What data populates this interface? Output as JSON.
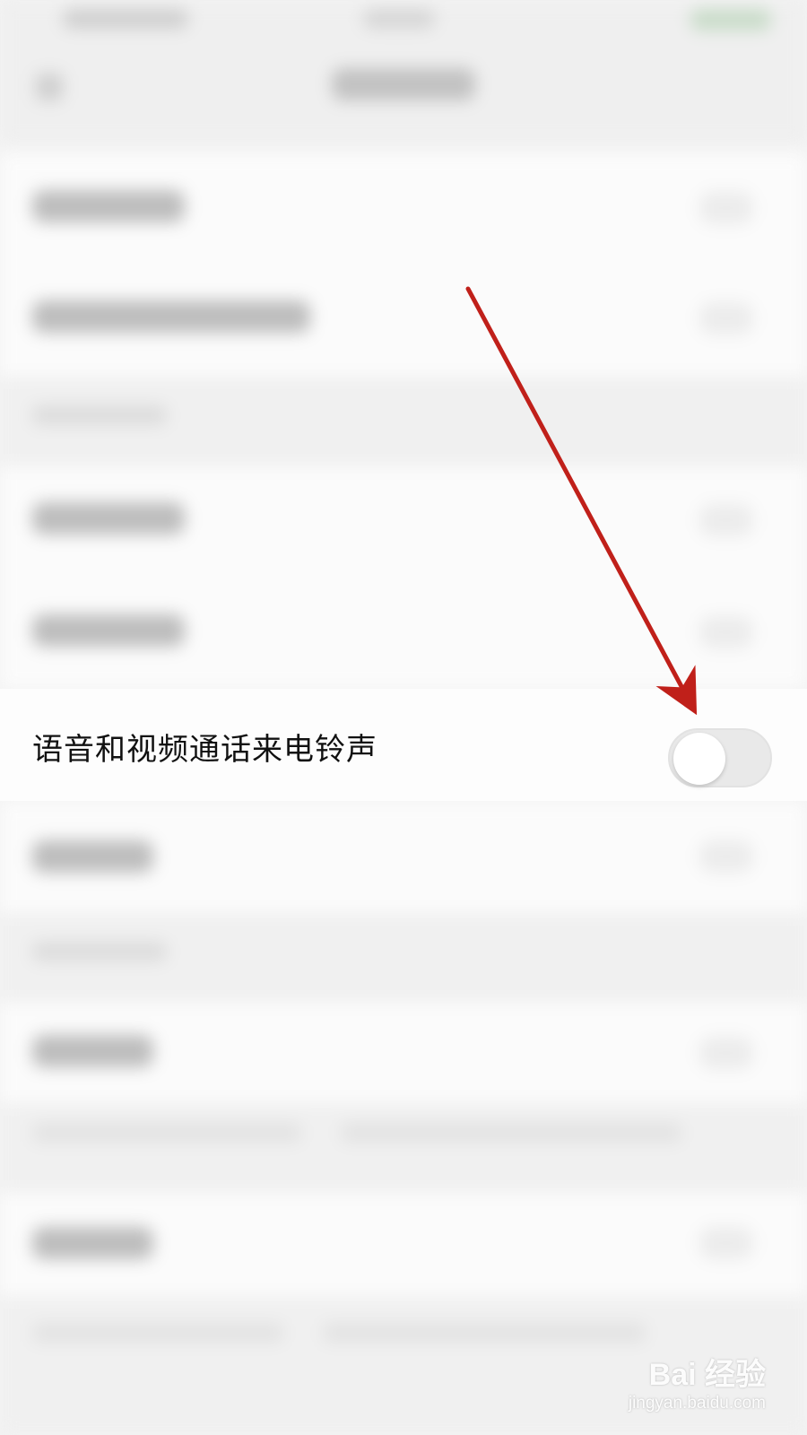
{
  "setting": {
    "label": "语音和视频通话来电铃声",
    "toggle_on": false
  },
  "annotation": {
    "arrow_color": "#c0201a"
  },
  "watermark": {
    "brand": "Bai 经验",
    "url": "jingyan.baidu.com"
  },
  "colors": {
    "background": "#f3f3f3",
    "row_background": "#fdfdfd",
    "toggle_off_track": "#e9e9e9"
  }
}
